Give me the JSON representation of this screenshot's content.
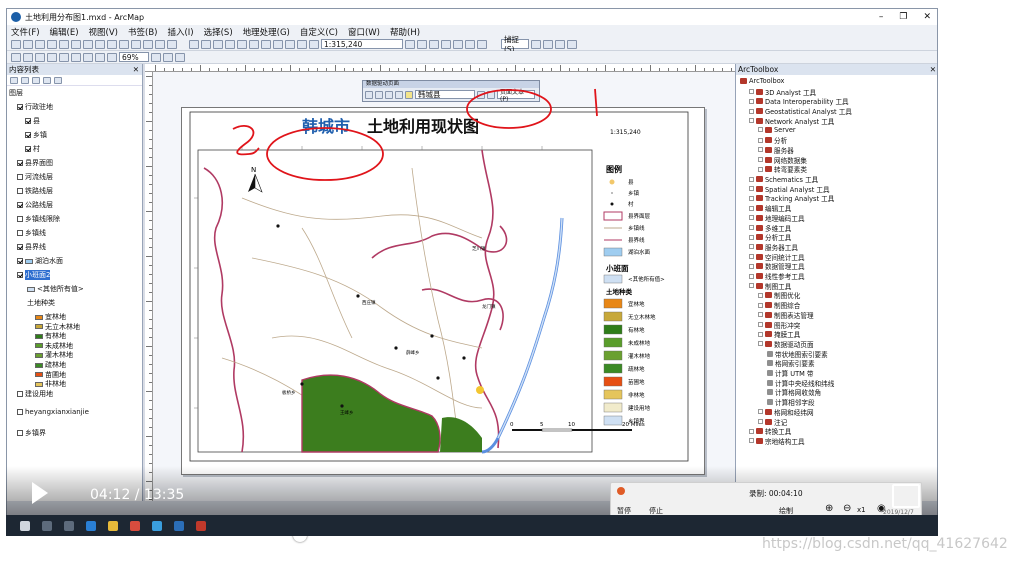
{
  "window": {
    "title": "土地利用分布图1.mxd - ArcMap"
  },
  "menu": [
    "文件(F)",
    "编辑(E)",
    "视图(V)",
    "书签(B)",
    "插入(I)",
    "选择(S)",
    "地理处理(G)",
    "自定义(C)",
    "窗口(W)",
    "帮助(H)"
  ],
  "toolbar": {
    "scale": "1:315,240",
    "zoom": "69%",
    "georef_label": "捕捉(S)"
  },
  "toc": {
    "title": "内容列表",
    "items": [
      {
        "label": "图层",
        "checked": null
      },
      {
        "label": "行政驻地",
        "checked": true
      },
      {
        "label": "县",
        "checked": true
      },
      {
        "label": "乡镇",
        "checked": true
      },
      {
        "label": "村",
        "checked": true
      },
      {
        "label": "县界面图",
        "checked": true
      },
      {
        "label": "河流线层",
        "checked": false
      },
      {
        "label": "铁路线层",
        "checked": false
      },
      {
        "label": "公路线层",
        "checked": true
      },
      {
        "label": "乡镇线限除",
        "checked": false
      },
      {
        "label": "乡镇线",
        "checked": false
      },
      {
        "label": "县界线",
        "checked": true
      },
      {
        "label": "湖泊水面",
        "checked": true
      },
      {
        "label": "小班面2",
        "checked": true
      },
      {
        "label": "<其他所有值>",
        "checked": null
      },
      {
        "label": "土地种类",
        "checked": null
      },
      {
        "label": "宜林地",
        "checked": null
      },
      {
        "label": "无立木林地",
        "checked": null
      },
      {
        "label": "有林地",
        "checked": null
      },
      {
        "label": "未成林地",
        "checked": null
      },
      {
        "label": "灌木林地",
        "checked": null
      },
      {
        "label": "疏林地",
        "checked": null
      },
      {
        "label": "苗圃地",
        "checked": null
      },
      {
        "label": "非林地",
        "checked": null
      },
      {
        "label": "建设用地",
        "checked": false
      },
      {
        "label": "heyangxianxianjie",
        "checked": false
      },
      {
        "label": "乡镇界",
        "checked": false
      }
    ]
  },
  "floatbar": {
    "title": "数据驱动页面",
    "field": "韩城县",
    "page_text": "页面文本(P)"
  },
  "map": {
    "title_city": "韩城市",
    "title_rest": "土地利用现状图",
    "scale": "1:315,240",
    "north": "N",
    "scalebar": [
      "0",
      "5",
      "10",
      "20 Miles"
    ],
    "legend_title": "图例",
    "legend_points": [
      "县",
      "乡镇",
      "村"
    ],
    "legend_lines": [
      "县界面层",
      "乡镇线",
      "县界线",
      "湖泊水面"
    ],
    "legend_class_header": "小班面",
    "legend_other": "<其他所有值>",
    "legend_land_header": "土地种类",
    "land_classes": [
      {
        "name": "宜林地",
        "color": "#e88716"
      },
      {
        "name": "无立木林地",
        "color": "#c7a83a"
      },
      {
        "name": "有林地",
        "color": "#2f7d19"
      },
      {
        "name": "未成林地",
        "color": "#5a9d2b"
      },
      {
        "name": "灌木林地",
        "color": "#6aa030"
      },
      {
        "name": "疏林地",
        "color": "#3b8a25"
      },
      {
        "name": "苗圃地",
        "color": "#e64f13"
      },
      {
        "name": "非林地",
        "color": "#e5c55c"
      },
      {
        "name": "建设用地",
        "color": "#f1ebcb"
      },
      {
        "name": "乡镇界",
        "color": "#cfe0f3"
      }
    ],
    "place_labels": [
      "芝川镇",
      "龙门镇",
      "西庄镇",
      "薛峰乡",
      "板桥乡",
      "王峰乡"
    ]
  },
  "annotations": {
    "one": "1",
    "two": "2"
  },
  "toolbox": {
    "title": "ArcToolbox",
    "items": [
      {
        "label": "ArcToolbox",
        "level": 0
      },
      {
        "label": "3D Analyst 工具",
        "level": 1
      },
      {
        "label": "Data Interoperability 工具",
        "level": 1
      },
      {
        "label": "Geostatistical Analyst 工具",
        "level": 1
      },
      {
        "label": "Network Analyst 工具",
        "level": 1
      },
      {
        "label": "Server",
        "level": 2
      },
      {
        "label": "分析",
        "level": 2
      },
      {
        "label": "服务器",
        "level": 2
      },
      {
        "label": "网络数据集",
        "level": 2
      },
      {
        "label": "转弯要素类",
        "level": 2
      },
      {
        "label": "Schematics 工具",
        "level": 1
      },
      {
        "label": "Spatial Analyst 工具",
        "level": 1
      },
      {
        "label": "Tracking Analyst 工具",
        "level": 1
      },
      {
        "label": "编辑工具",
        "level": 1
      },
      {
        "label": "地理编码工具",
        "level": 1
      },
      {
        "label": "多维工具",
        "level": 1
      },
      {
        "label": "分析工具",
        "level": 1
      },
      {
        "label": "服务器工具",
        "level": 1
      },
      {
        "label": "空间统计工具",
        "level": 1
      },
      {
        "label": "数据管理工具",
        "level": 1
      },
      {
        "label": "线性参考工具",
        "level": 1
      },
      {
        "label": "制图工具",
        "level": 1
      },
      {
        "label": "制图优化",
        "level": 2
      },
      {
        "label": "制图综合",
        "level": 2
      },
      {
        "label": "制图表达管理",
        "level": 2
      },
      {
        "label": "图形冲突",
        "level": 2
      },
      {
        "label": "掩膜工具",
        "level": 2
      },
      {
        "label": "数据驱动页面",
        "level": 2
      },
      {
        "label": "带状地图索引要素",
        "level": 3
      },
      {
        "label": "格网索引要素",
        "level": 3
      },
      {
        "label": "计算 UTM 带",
        "level": 3
      },
      {
        "label": "计算中央经线和纬线",
        "level": 3
      },
      {
        "label": "计算格网收敛角",
        "level": 3
      },
      {
        "label": "计算相邻字段",
        "level": 3
      },
      {
        "label": "格网和经纬网",
        "level": 2
      },
      {
        "label": "注记",
        "level": 2
      },
      {
        "label": "转换工具",
        "level": 1
      },
      {
        "label": "宗地结构工具",
        "level": 1
      }
    ]
  },
  "player": {
    "time": "04:12 / 13:35"
  },
  "recorder": {
    "label": "录制: 00:04:10",
    "pause": "暂停",
    "stop": "停止",
    "speed": "x1",
    "draw": "绘制"
  },
  "taskbar": {
    "clock": "2019/12/7"
  },
  "watermark": "https://blog.csdn.net/qq_41627642",
  "colors": {
    "annotation_red": "#e0141a",
    "title_blue": "#1f5fae",
    "county_border": "#b03a63",
    "river": "#5b8fe0"
  }
}
